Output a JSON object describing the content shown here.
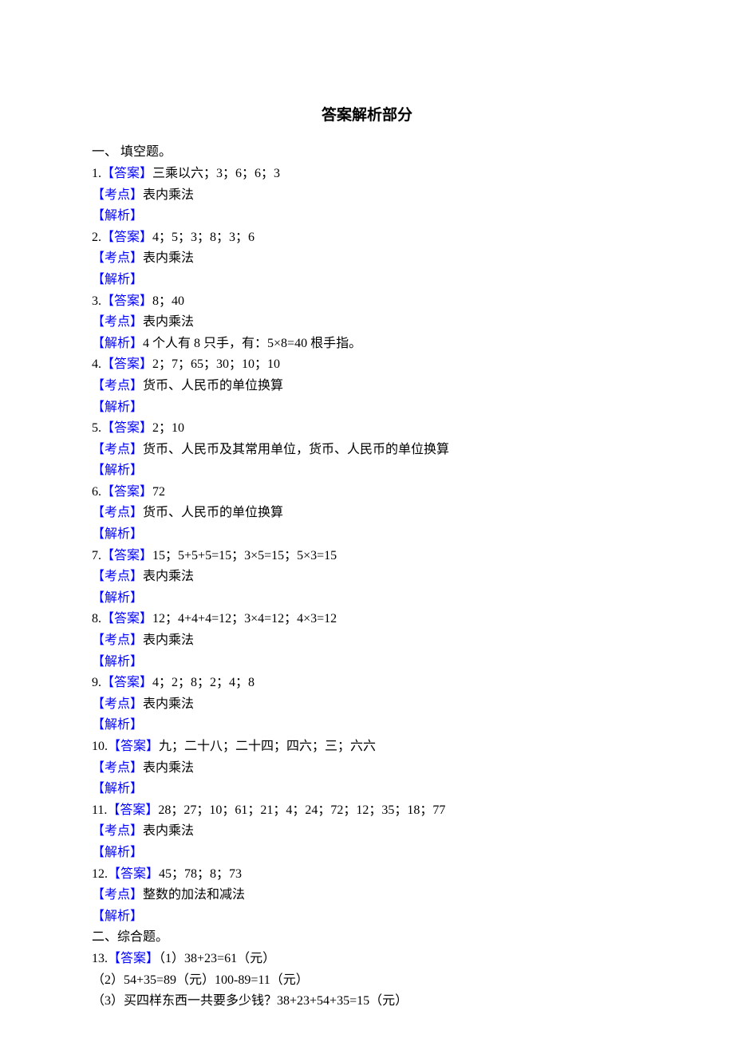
{
  "title": "答案解析部分",
  "section1_heading": "一、   填空题。",
  "label_answer": "【答案】",
  "label_point": "【考点】",
  "label_explain": "【解析】",
  "q1": {
    "num": "1.",
    "answer": "三乘以六；3；6；6；3",
    "point": "表内乘法"
  },
  "q2": {
    "num": "2.",
    "answer": "4；5；3；8；3；6",
    "point": "表内乘法"
  },
  "q3": {
    "num": "3.",
    "answer": "8；40",
    "point": "表内乘法",
    "explain": "4 个人有 8 只手，有：5×8=40 根手指。"
  },
  "q4": {
    "num": "4.",
    "answer": "2；7；65；30；10；10",
    "point": "货币、人民币的单位换算"
  },
  "q5": {
    "num": "5.",
    "answer": "2；10",
    "point": "货币、人民币及其常用单位，货币、人民币的单位换算"
  },
  "q6": {
    "num": "6.",
    "answer": "72",
    "point": "货币、人民币的单位换算"
  },
  "q7": {
    "num": "7.",
    "answer": "15；5+5+5=15；3×5=15；5×3=15",
    "point": "表内乘法"
  },
  "q8": {
    "num": "8.",
    "answer": "12；4+4+4=12；3×4=12；4×3=12",
    "point": "表内乘法"
  },
  "q9": {
    "num": "9.",
    "answer": "4；2；8；2；4；8",
    "point": "表内乘法"
  },
  "q10": {
    "num": "10.",
    "answer": "九；二十八；二十四；四六；三；六六",
    "point": "表内乘法"
  },
  "q11": {
    "num": "11.",
    "answer": "28；27；10；61；21；4；24；72；12；35；18；77",
    "point": "表内乘法"
  },
  "q12": {
    "num": "12.",
    "answer": "45；78；8；73",
    "point": "整数的加法和减法"
  },
  "section2_heading": "二、综合题。",
  "q13": {
    "num": "13.",
    "part1": "（1）38+23=61（元）",
    "part2": "（2）54+35=89（元）100-89=11（元）",
    "part3": "（3）买四样东西一共要多少钱？38+23+54+35=15（元）"
  }
}
